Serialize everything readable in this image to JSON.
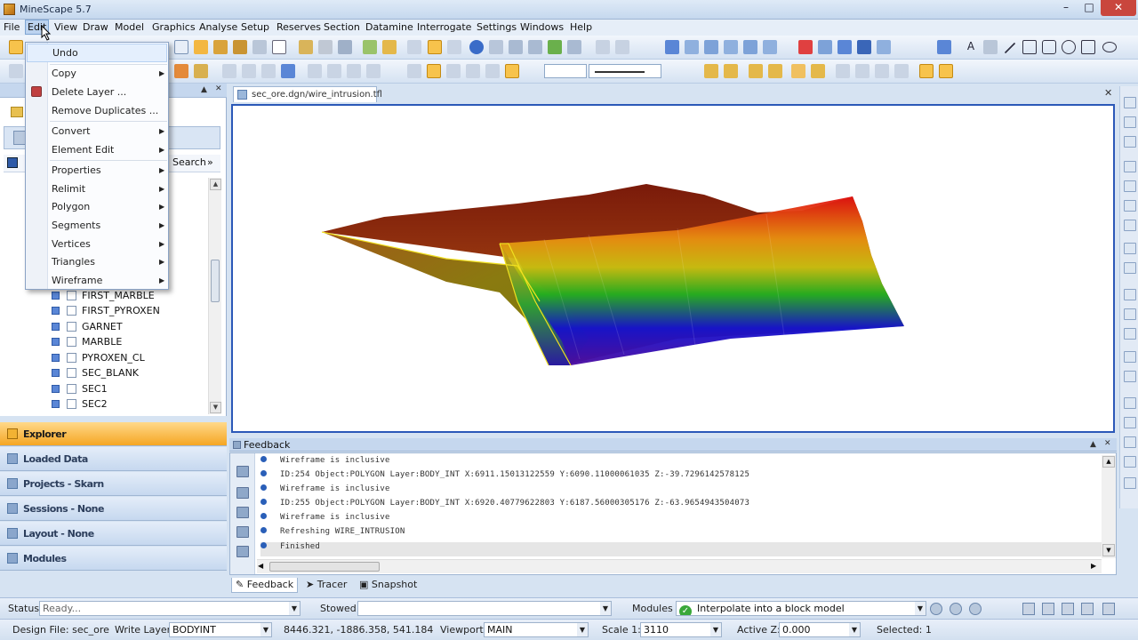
{
  "window": {
    "title": "MineScape 5.7"
  },
  "menu": [
    "File",
    "Edit",
    "View",
    "Draw",
    "Model",
    "Graphics",
    "Analyse",
    "Setup",
    "Reserves",
    "Section",
    "Datamine",
    "Interrogate",
    "Settings",
    "Windows",
    "Help"
  ],
  "edit_menu": {
    "items": [
      {
        "label": "Undo",
        "submenu": false
      },
      {
        "label": "Copy",
        "submenu": true
      },
      {
        "label": "Delete Layer ...",
        "submenu": false
      },
      {
        "label": "Remove Duplicates ...",
        "submenu": false
      },
      {
        "label": "Convert",
        "submenu": true
      },
      {
        "label": "Element Edit",
        "submenu": true
      },
      {
        "label": "Properties",
        "submenu": true
      },
      {
        "label": "Relimit",
        "submenu": true
      },
      {
        "label": "Polygon",
        "submenu": true
      },
      {
        "label": "Segments",
        "submenu": true
      },
      {
        "label": "Vertices",
        "submenu": true
      },
      {
        "label": "Triangles",
        "submenu": true
      },
      {
        "label": "Wireframe",
        "submenu": true
      }
    ]
  },
  "left_panel": {
    "search_label": "Search",
    "search_more": "»",
    "tree_items": [
      "FIRST_MARBLE",
      "FIRST_PYROXEN",
      "GARNET",
      "MARBLE",
      "PYROXEN_CL",
      "SEC_BLANK",
      "SEC1",
      "SEC2"
    ]
  },
  "nav_buttons": [
    "Explorer",
    "Loaded Data",
    "Projects - Skarn",
    "Sessions - None",
    "Layout - None",
    "Modules"
  ],
  "document": {
    "tab_label": "sec_ore.dgn/wire_intrusion.tfl"
  },
  "feedback": {
    "title": "Feedback",
    "lines": [
      "Wireframe is inclusive",
      "ID:254 Object:POLYGON Layer:BODY_INT X:6911.15013122559 Y:6090.11000061035 Z:-39.7296142578125",
      "Wireframe is inclusive",
      "ID:255 Object:POLYGON Layer:BODY_INT X:6920.40779622803 Y:6187.56000305176 Z:-63.9654943504073",
      "Wireframe is inclusive",
      "Refreshing WIRE_INTRUSION",
      "Finished"
    ]
  },
  "bottom_tabs": [
    "Feedback",
    "Tracer",
    "Snapshot"
  ],
  "status": {
    "status_label": "Status",
    "status_value": "Ready...",
    "stowed_label": "Stowed",
    "modules_label": "Modules",
    "module_value": "Interpolate into a block model",
    "design_file": "Design File: sec_ore",
    "write_layer_label": "Write Layer:",
    "write_layer_value": "BODYINT",
    "coords": "8446.321, -1886.358, 541.184",
    "viewport_label": "Viewport:",
    "viewport_value": "MAIN",
    "scale_label": "Scale 1:",
    "scale_value": "3110",
    "activez_label": "Active Z:",
    "activez_value": "0.000",
    "selected": "Selected: 1"
  }
}
